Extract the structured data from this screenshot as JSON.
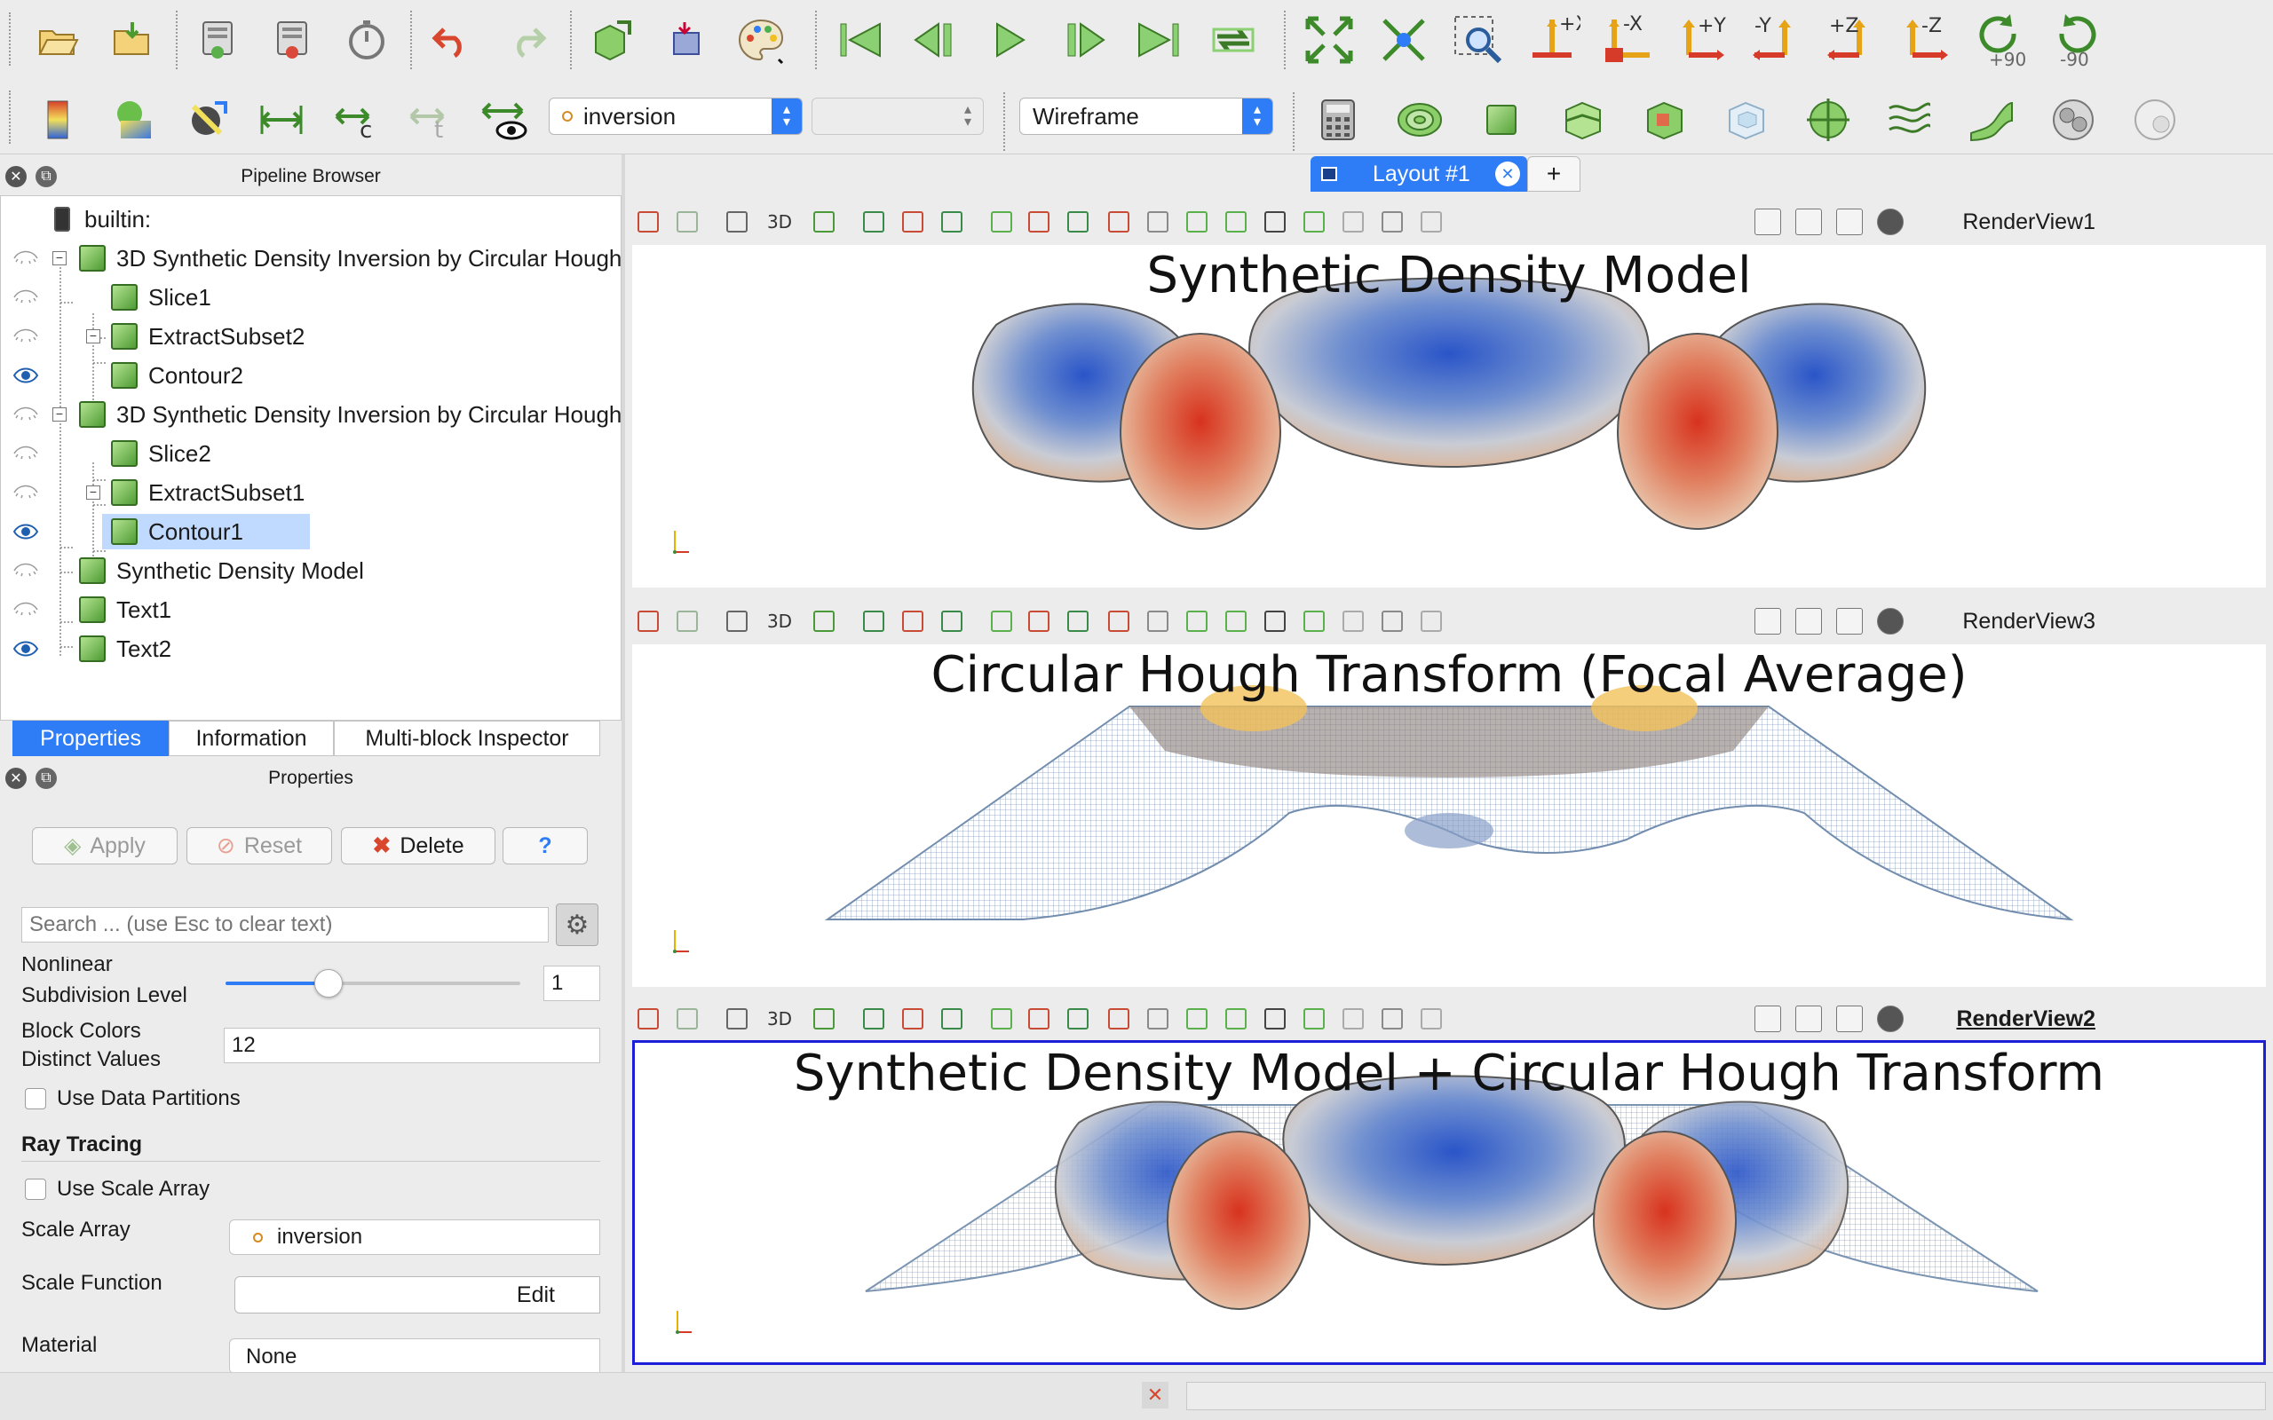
{
  "colors": {
    "accent": "#2f7df6",
    "active_border": "#1d1fd8",
    "selection": "#bfd9ff"
  },
  "toolbar_main": {
    "icons": [
      "open-icon",
      "save-state-icon",
      "connect-icon",
      "disconnect-icon",
      "timer-icon",
      "undo-icon",
      "redo-icon",
      "filter-icon",
      "select-icon",
      "palette-icon",
      "first-frame-icon",
      "previous-frame-icon",
      "play-icon",
      "next-frame-icon",
      "last-frame-icon",
      "loop-icon",
      "reset-camera-icon",
      "zoom-to-data-icon",
      "zoom-to-box-icon"
    ],
    "camera_buttons": [
      "+X",
      "-X",
      "+Y",
      "-Y",
      "+Z",
      "-Z"
    ],
    "rotate_labels": [
      "+90",
      "-90"
    ]
  },
  "toolbar_display": {
    "color_array": "inversion",
    "component": "",
    "representation": "Wireframe"
  },
  "pipeline": {
    "title": "Pipeline Browser",
    "items": [
      {
        "label": "builtin:",
        "eye": "none",
        "depth": 0,
        "selected": false
      },
      {
        "label": "3D Synthetic Density Inversion by Circular Hough Transform",
        "eye": "hidden",
        "depth": 1,
        "selected": false
      },
      {
        "label": "Slice1",
        "eye": "hidden",
        "depth": 2,
        "selected": false
      },
      {
        "label": "ExtractSubset2",
        "eye": "hidden",
        "depth": 2,
        "selected": false
      },
      {
        "label": "Contour2",
        "eye": "visible",
        "depth": 2,
        "selected": false
      },
      {
        "label": "3D Synthetic Density Inversion by Circular Hough Transform",
        "eye": "hidden",
        "depth": 1,
        "selected": false
      },
      {
        "label": "Slice2",
        "eye": "hidden",
        "depth": 2,
        "selected": false
      },
      {
        "label": "ExtractSubset1",
        "eye": "hidden",
        "depth": 2,
        "selected": false
      },
      {
        "label": "Contour1",
        "eye": "visible",
        "depth": 2,
        "selected": true
      },
      {
        "label": "Synthetic Density Model",
        "eye": "hidden",
        "depth": 1,
        "selected": false
      },
      {
        "label": "Text1",
        "eye": "hidden",
        "depth": 1,
        "selected": false
      },
      {
        "label": "Text2",
        "eye": "visible",
        "depth": 1,
        "selected": false
      }
    ]
  },
  "tabs": [
    "Properties",
    "Information",
    "Multi-block Inspector"
  ],
  "properties": {
    "title": "Properties",
    "apply": "Apply",
    "reset": "Reset",
    "delete": "Delete",
    "help": "?",
    "search_placeholder": "Search ... (use Esc to clear text)",
    "nonlinear_label_top": "Nonlinear",
    "nonlinear_label": "Subdivision Level",
    "nonlinear_value": "1",
    "nonlinear_fraction": 0.35,
    "block_colors_label1": "Block Colors",
    "block_colors_label2": "Distinct Values",
    "block_colors_value": "12",
    "use_data_partitions": "Use Data Partitions",
    "ray_tracing": "Ray Tracing",
    "use_scale_array": "Use Scale Array",
    "scale_array_label": "Scale Array",
    "scale_array_value": "inversion",
    "scale_function_label": "Scale Function",
    "scale_function_button": "Edit",
    "material_label": "Material",
    "material_value": "None"
  },
  "layout": {
    "tab": "Layout #1",
    "add": "+"
  },
  "views": [
    {
      "name": "RenderView1",
      "title": "Synthetic Density Model",
      "active": false
    },
    {
      "name": "RenderView3",
      "title": "Circular Hough Transform (Focal Average)",
      "active": false
    },
    {
      "name": "RenderView2",
      "title": "Synthetic Density Model + Circular Hough Transform",
      "active": true
    }
  ],
  "view_toolbar": {
    "three_d": "3D"
  }
}
